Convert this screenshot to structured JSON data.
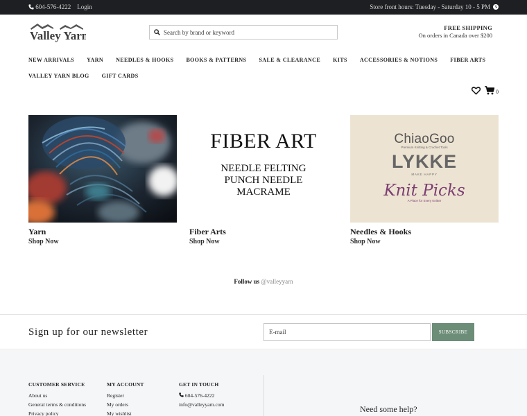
{
  "topbar": {
    "phone": "604-576-4222",
    "login": "Login",
    "hours": "Store front hours: Tuesday - Saturday 10 - 5 PM"
  },
  "brand": {
    "logo_text": "Valley Yarn"
  },
  "search": {
    "placeholder": "Search by brand or keyword"
  },
  "shipping": {
    "title": "FREE SHIPPING",
    "subtitle": "On orders in Canada over $200"
  },
  "nav": {
    "row1": [
      "NEW ARRIVALS",
      "YARN",
      "NEEDLES & HOOKS",
      "BOOKS & PATTERNS",
      "SALE & CLEARANCE",
      "KITS",
      "ACCESSORIES & NOTIONS",
      "FIBER ARTS"
    ],
    "row2": [
      "VALLEY YARN BLOG",
      "GIFT CARDS"
    ]
  },
  "cart": {
    "count": "0"
  },
  "tiles": [
    {
      "title": "Yarn",
      "link": "Shop Now"
    },
    {
      "title": "Fiber Arts",
      "link": "Shop Now",
      "image_text": {
        "heading": "FIBER ART",
        "lines": [
          "NEEDLE FELTING",
          "PUNCH NEEDLE",
          "MACRAME"
        ]
      }
    },
    {
      "title": "Needles & Hooks",
      "link": "Shop Now",
      "image_text": {
        "brand1": "ChiaoGoo",
        "brand1_tag": "Premium Knitting & Crochet Tools",
        "brand2": "LYKKE",
        "brand2_tag": "MAKE HAPPY",
        "brand3": "Knit Picks",
        "brand3_tag": "A Place for Every Knitter"
      }
    }
  ],
  "follow": {
    "label": "Follow us",
    "handle": "@valleyyarn"
  },
  "newsletter": {
    "heading": "Sign up for our newsletter",
    "placeholder": "E-mail",
    "button": "SUBSCRIBE"
  },
  "footer": {
    "customer_service": {
      "heading": "CUSTOMER SERVICE",
      "links": [
        "About us",
        "General terms & conditions",
        "Privacy policy"
      ]
    },
    "my_account": {
      "heading": "MY ACCOUNT",
      "links": [
        "Register",
        "My orders",
        "My wishlist"
      ]
    },
    "get_in_touch": {
      "heading": "GET IN TOUCH",
      "phone": "604-576-4222",
      "email": "info@valleyyarn.com"
    },
    "help": "Need some help?"
  },
  "colors": {
    "topbar_bg": "#1d1f22",
    "subscribe_bg": "#6c8d77",
    "footer_bg": "#f5f6f8"
  }
}
